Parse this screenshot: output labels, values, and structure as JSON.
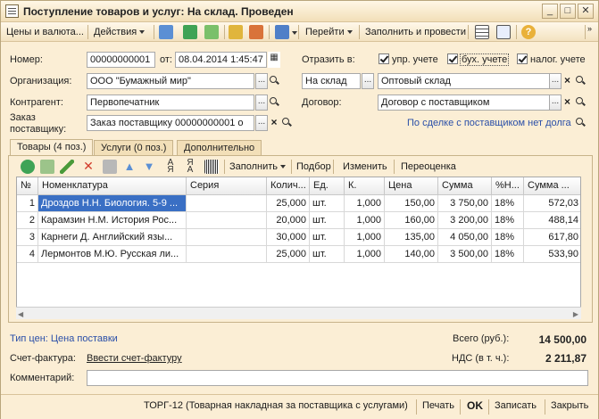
{
  "window": {
    "title": "Поступление товаров и услуг: На склад. Проведен",
    "min_label": "_",
    "max_label": "□",
    "close_label": "✕"
  },
  "toolbar": {
    "prices_currency": "Цены и валюта...",
    "actions": "Действия",
    "goto": "Перейти",
    "fill_and_post": "Заполнить и провести",
    "help": "?"
  },
  "form": {
    "number_label": "Номер:",
    "number_value": "00000000001",
    "from_label": "от:",
    "date_value": "08.04.2014  1:45:47",
    "reflect_label": "Отразить в:",
    "reflect_mgmt": "упр. учете",
    "reflect_acc": "бух. учете",
    "reflect_tax": "налог. учете",
    "org_label": "Организация:",
    "org_value": "ООО \"Бумажный мир\"",
    "op_type_value": "На склад",
    "warehouse_value": "Оптовый склад",
    "counterparty_label": "Контрагент:",
    "counterparty_value": "Первопечатник",
    "contract_label": "Договор:",
    "contract_value": "Договор с поставщиком",
    "order_label_1": "Заказ",
    "order_label_2": "поставщику:",
    "order_value": "Заказ поставщику 00000000001 о",
    "debt_link": "По сделке с поставщиком нет долга",
    "dots": "...",
    "clear": "×"
  },
  "tabs": [
    {
      "label": "Товары (4 поз.)"
    },
    {
      "label": "Услуги (0 поз.)"
    },
    {
      "label": "Дополнительно"
    }
  ],
  "grid_toolbar": {
    "fill": "Заполнить",
    "pick": "Подбор",
    "change": "Изменить",
    "revalue": "Переоценка"
  },
  "grid": {
    "columns": [
      "№",
      "Номенклатура",
      "Серия",
      "Колич...",
      "Ед.",
      "К.",
      "Цена",
      "Сумма",
      "%Н...",
      "Сумма ..."
    ],
    "rows": [
      [
        "1",
        "Дроздов Н.Н. Биология. 5-9 ...",
        "",
        "25,000",
        "шт.",
        "1,000",
        "150,00",
        "3 750,00",
        "18%",
        "572,03"
      ],
      [
        "2",
        "Карамзин Н.М. История Рос...",
        "",
        "20,000",
        "шт.",
        "1,000",
        "160,00",
        "3 200,00",
        "18%",
        "488,14"
      ],
      [
        "3",
        "Карнеги Д. Английский язы...",
        "",
        "30,000",
        "шт.",
        "1,000",
        "135,00",
        "4 050,00",
        "18%",
        "617,80"
      ],
      [
        "4",
        "Лермонтов М.Ю. Русская ли...",
        "",
        "25,000",
        "шт.",
        "1,000",
        "140,00",
        "3 500,00",
        "18%",
        "533,90"
      ]
    ]
  },
  "summary": {
    "price_type_link": "Тип цен: Цена поставки",
    "total_label": "Всего (руб.):",
    "total_value": "14 500,00",
    "invoice_label": "Счет-фактура:",
    "invoice_link": "Ввести счет-фактуру",
    "vat_label": "НДС (в т. ч.):",
    "vat_value": "2 211,87",
    "comment_label": "Комментарий:",
    "comment_value": ""
  },
  "footer": {
    "torg12": "ТОРГ-12 (Товарная накладная за поставщика с услугами)",
    "print": "Печать",
    "ok": "OK",
    "save": "Записать",
    "close": "Закрыть"
  },
  "colors": {
    "accent_selection": "#3a6fc4",
    "link": "#2a4fa8",
    "window_bg": "#fbeed5"
  }
}
